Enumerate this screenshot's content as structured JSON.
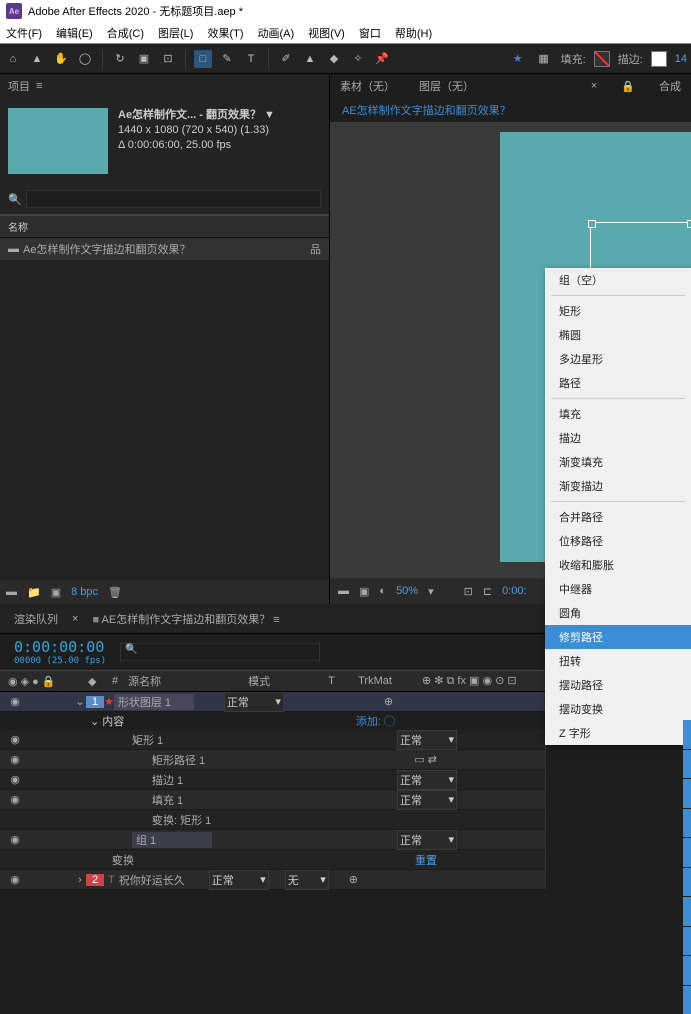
{
  "title": "Adobe After Effects 2020 - 无标题项目.aep *",
  "ae_abbr": "Ae",
  "menu": [
    "文件(F)",
    "编辑(E)",
    "合成(C)",
    "图层(L)",
    "效果(T)",
    "动画(A)",
    "视图(V)",
    "窗口",
    "帮助(H)"
  ],
  "toolbar_right": {
    "fill": "填充:",
    "stroke": "描边:",
    "stroke_px": "14"
  },
  "project_panel": {
    "tab": "项目",
    "selected_name": "Ae怎样制作文... - 翻页效果？ ▼",
    "meta1": "1440 x 1080 (720 x 540) (1.33)",
    "meta2": "Δ 0:00:06:00, 25.00 fps",
    "col": "名称",
    "item": "Ae怎样制作文字描边和翻页效果？",
    "bpc": "8 bpc"
  },
  "viewer": {
    "tabs": [
      "素材（无）",
      "图层（无）",
      "合成"
    ],
    "comp": "AE怎样制作文字描边和翻页效果？",
    "zoom": "50%",
    "time": "0:00:"
  },
  "ctx": {
    "g1": [
      "组（空）"
    ],
    "g2": [
      "矩形",
      "椭圆",
      "多边星形",
      "路径"
    ],
    "g3": [
      "填充",
      "描边",
      "渐变填充",
      "渐变描边"
    ],
    "g4": [
      "合并路径",
      "位移路径",
      "收缩和膨胀",
      "中继器",
      "圆角",
      "修剪路径",
      "扭转",
      "摆动路径",
      "摆动变换",
      "Z 字形"
    ],
    "selected": "修剪路径"
  },
  "timeline": {
    "tab_queue": "渲染队列",
    "tab_comp": "AE怎样制作文字描边和翻页效果？",
    "timecode": "0:00:00:00",
    "frames": "00000 (25.00 fps)",
    "hdr": {
      "num": "#",
      "src": "源名称",
      "mode": "模式",
      "trk": "TrkMat"
    },
    "layer1": {
      "num": "1",
      "name": "形状图层 1",
      "mode": "正常"
    },
    "add": "添加: ◯",
    "rect1": "矩形 1",
    "rectpath": "矩形路径 1",
    "stroke": "描边 1",
    "fill": "填充 1",
    "xform_rect": "变换: 矩形 1",
    "group1": "组 1",
    "xform": "变换",
    "reset": "重置",
    "layer2": {
      "num": "2",
      "name": "祝你好运长久",
      "mode": "正常",
      "trk": "无",
      "parent": "无"
    },
    "normal": "正常"
  }
}
